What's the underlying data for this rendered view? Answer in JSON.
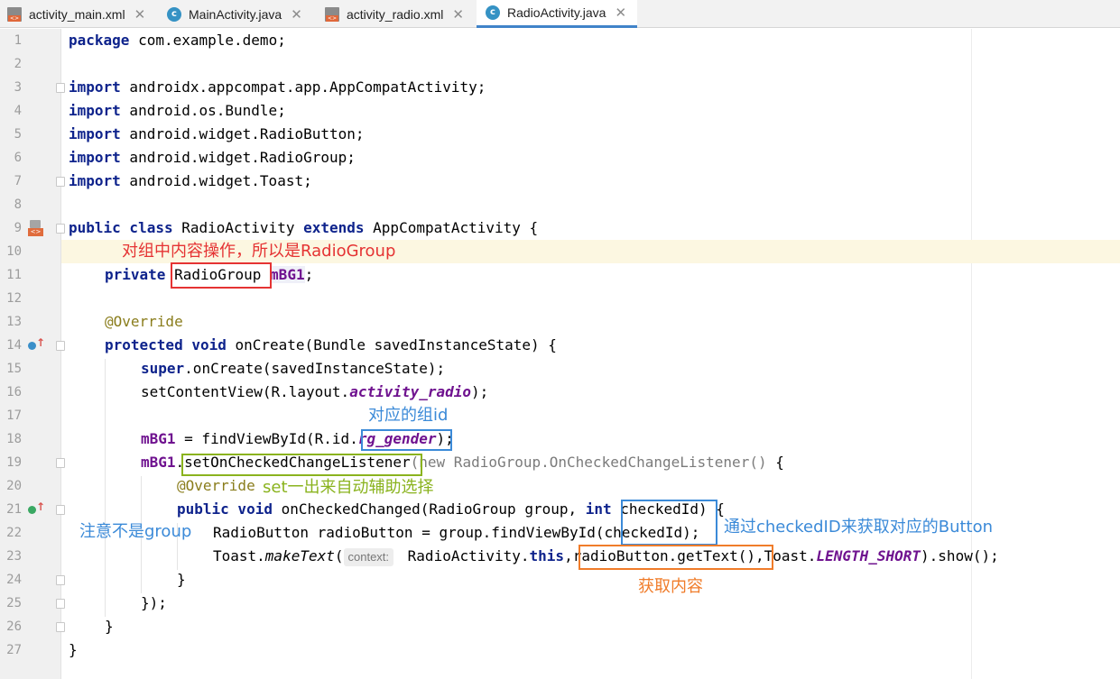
{
  "tabs": [
    {
      "label": "activity_main.xml",
      "icon": "xml-file-icon",
      "active": false
    },
    {
      "label": "MainActivity.java",
      "icon": "java-class-icon",
      "active": false
    },
    {
      "label": "activity_radio.xml",
      "icon": "xml-file-icon",
      "active": false
    },
    {
      "label": "RadioActivity.java",
      "icon": "java-class-icon",
      "active": true
    }
  ],
  "close_glyph": "✕",
  "java_icon_letter": "c",
  "xml_icon_text": "<>",
  "current_line": 10,
  "line_numbers": [
    "1",
    "2",
    "3",
    "4",
    "5",
    "6",
    "7",
    "8",
    "9",
    "10",
    "11",
    "12",
    "13",
    "14",
    "15",
    "16",
    "17",
    "18",
    "19",
    "20",
    "21",
    "22",
    "23",
    "24",
    "25",
    "26",
    "27"
  ],
  "code": {
    "l1": {
      "kw": "package",
      "rest": " com.example.demo;"
    },
    "l3": {
      "kw": "import",
      "rest": " androidx.appcompat.app.AppCompatActivity;"
    },
    "l4": {
      "kw": "import",
      "rest": " android.os.Bundle;"
    },
    "l5": {
      "kw": "import",
      "rest": " android.widget.RadioButton;"
    },
    "l6": {
      "kw": "import",
      "rest": " android.widget.RadioGroup;"
    },
    "l7": {
      "kw": "import",
      "rest": " android.widget.Toast;"
    },
    "l9": {
      "kw1": "public class",
      "name": " RadioActivity ",
      "kw2": "extends",
      "rest": " AppCompatActivity {"
    },
    "l11": {
      "kw": "private",
      "sp": " ",
      "type": "RadioGroup",
      "sp2": " ",
      "field": "mBG1",
      "rest": ";"
    },
    "l13": {
      "ann": "@Override"
    },
    "l14": {
      "kw": "protected void",
      "rest": " onCreate(Bundle savedInstanceState) {"
    },
    "l15": {
      "kw": "super",
      "rest": ".onCreate(savedInstanceState);"
    },
    "l16": {
      "pre": "setContentView(R.layout.",
      "field": "activity_radio",
      "rest": ");"
    },
    "l18": {
      "field": "mBG1",
      "pre": " = findViewById(R.id.",
      "id": "rg_gender",
      "rest": ");"
    },
    "l19": {
      "field": "mBG1",
      "dot": ".",
      "method": "setOnCheckedChangeListener",
      "open": "(",
      "kw": "new",
      "anon": " RadioGroup.OnCheckedChangeListener()",
      "rest": " {"
    },
    "l20": {
      "ann": "@Override"
    },
    "l21": {
      "kw": "public void",
      "pre": " onCheckedChanged(RadioGroup group, ",
      "kw2": "int",
      "rest": " checkedId) {"
    },
    "l22": {
      "text": "RadioButton radioButton = group.findViewById(checkedId);"
    },
    "l23": {
      "pre": "Toast.",
      "method": "makeText",
      "open": "(",
      "hint": "context:",
      "mid": " RadioActivity.",
      "kw": "this",
      "comma": ",",
      "call": "radioButton.getText()",
      "mid2": ",Toast.",
      "const": "LENGTH_SHORT",
      "rest": ").show();"
    },
    "l24": {
      "text": "}"
    },
    "l25": {
      "text": "});"
    },
    "l26": {
      "text": "}"
    },
    "l27": {
      "text": "}"
    }
  },
  "annotations": {
    "radiogroup_note": "对组中内容操作，所以是RadioGroup",
    "group_id_note": "对应的组id",
    "listener_note": "set一出来自动辅助选择",
    "not_group_note": "注意不是group",
    "checked_id_note": "通过checkedID来获取对应的Button",
    "get_text_note": "获取内容"
  },
  "colors": {
    "red": "#e53333",
    "blue": "#3b8ad8",
    "green": "#8ab31e",
    "orange": "#f07c2a",
    "keyword": "#0e238c",
    "field": "#6f128f",
    "annotation": "#8a7d1c",
    "current_line_bg": "#fcf7e1"
  }
}
